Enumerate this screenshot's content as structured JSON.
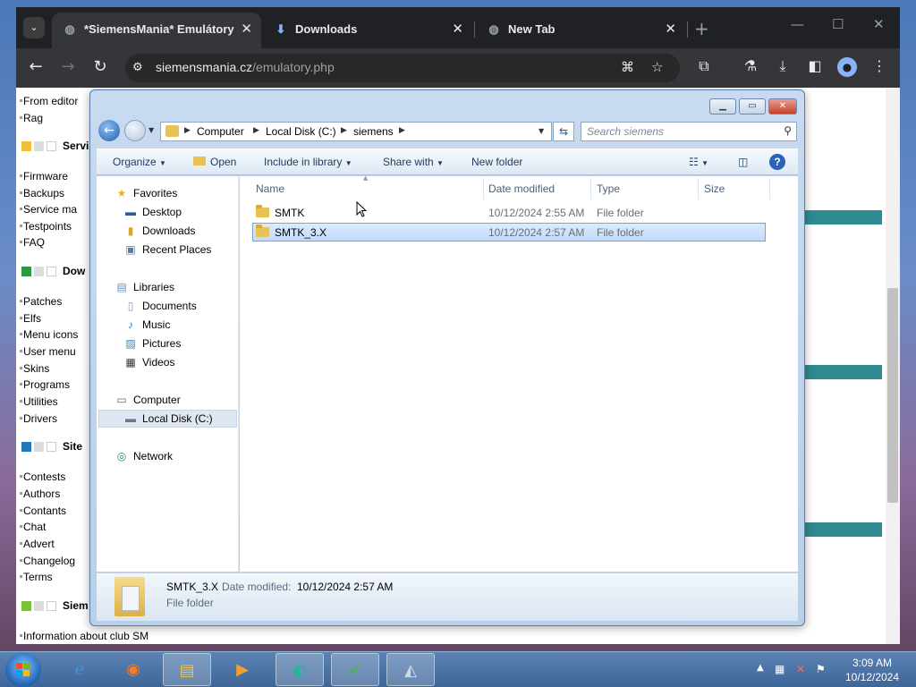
{
  "browser": {
    "tabs": [
      {
        "title": "*SiemensMania* Emulátory",
        "active": true
      },
      {
        "title": "Downloads",
        "active": false
      },
      {
        "title": "New Tab",
        "active": false
      }
    ],
    "url_host": "siemensmania.cz",
    "url_path": "/emulatory.php"
  },
  "webpage": {
    "top_links": [
      "From editor",
      "Rag"
    ],
    "sections": [
      {
        "label": "Servi",
        "color": "#f2c037",
        "links": [
          "Firmware",
          "Backups",
          "Service ma",
          "Testpoints",
          "FAQ"
        ]
      },
      {
        "label": "Dow",
        "color": "#2e9a3c",
        "links": [
          "Patches",
          "Elfs",
          "Menu icons",
          "User menu",
          "Skins",
          "Programs",
          "Utilities",
          "Drivers"
        ]
      },
      {
        "label": "Site",
        "color": "#1e7ab8",
        "links": [
          "Contests",
          "Authors",
          "Contants",
          "Chat",
          "Advert",
          "Changelog",
          "Terms"
        ]
      },
      {
        "label": "Siem",
        "color": "#7ac23c",
        "links": [
          "Information about club SM"
        ]
      }
    ]
  },
  "explorer": {
    "breadcrumb": [
      "Computer",
      "Local Disk (C:)",
      "siemens"
    ],
    "search_placeholder": "Search siemens",
    "commands": [
      "Organize",
      "Open",
      "Include in library",
      "Share with",
      "New folder"
    ],
    "nav": {
      "favorites_header": "Favorites",
      "favorites": [
        "Desktop",
        "Downloads",
        "Recent Places"
      ],
      "libraries_header": "Libraries",
      "libraries": [
        "Documents",
        "Music",
        "Pictures",
        "Videos"
      ],
      "computer_header": "Computer",
      "computer_items": [
        "Local Disk (C:)"
      ],
      "network_header": "Network"
    },
    "columns": [
      "Name",
      "Date modified",
      "Type",
      "Size"
    ],
    "files": [
      {
        "name": "SMTK",
        "date": "10/12/2024 2:55 AM",
        "type": "File folder",
        "selected": false
      },
      {
        "name": "SMTK_3.X",
        "date": "10/12/2024 2:57 AM",
        "type": "File folder",
        "selected": true
      }
    ],
    "details": {
      "name": "SMTK_3.X",
      "date_label": "Date modified:",
      "date_value": "10/12/2024 2:57 AM",
      "type": "File folder"
    }
  },
  "taskbar": {
    "time": "3:09 AM",
    "date": "10/12/2024"
  }
}
